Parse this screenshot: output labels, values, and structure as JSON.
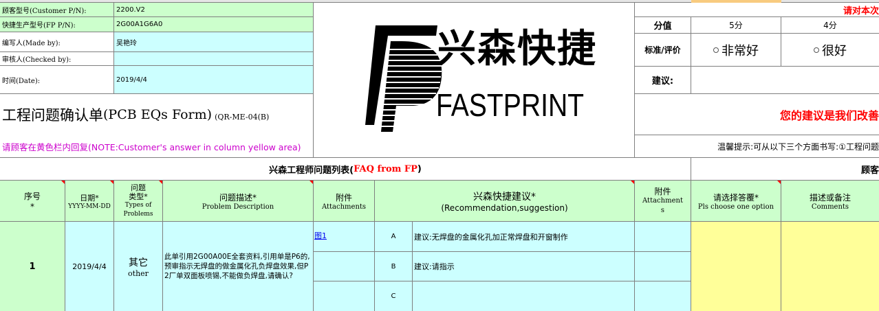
{
  "info": {
    "customer_pn_label": "顾客型号(Customer P/N):",
    "customer_pn_value": "2200.V2",
    "fp_pn_label": "快捷生产型号(FP P/N):",
    "fp_pn_value": "2G00A1G6A0",
    "made_by_label": "编写人(Made by):",
    "made_by_value": "吴艳玲",
    "checked_by_label": "审核人(Checked by):",
    "checked_by_value": "",
    "date_label": "时间(Date):",
    "date_value": "2019/4/4"
  },
  "form_title": {
    "main": "工程问题确认单",
    "en": "(PCB EQs Form)",
    "code": "(QR-ME-04(B)"
  },
  "notice": "请顾客在黄色栏内回复(NOTE:Customer's answer in column yellow area)",
  "logo": {
    "cn": "兴森快捷",
    "en": "FASTPRINT"
  },
  "rating": {
    "top_right_red": "请对本次",
    "score_label": "分值",
    "score_5": "5分",
    "score_4": "4分",
    "standard_label": "标准/评价",
    "option_1": "非常好",
    "option_2": "很好",
    "advice_label": "建议:",
    "improve_text": "您的建议是我们改善",
    "tip_text": "温馨提示:可从以下三个方面书写:①工程问题"
  },
  "section": {
    "left_title_cn": "兴森工程师问题列表(",
    "left_title_faq": "FAQ from FP",
    "left_title_end": ")",
    "right_title": "顾客"
  },
  "headers": {
    "seq": "序号",
    "seq_star": "*",
    "date": "日期*",
    "date_fmt": "YYYY-MM-DD",
    "type_1": "问题",
    "type_2": "类型*",
    "type_3": "Types of",
    "type_4": "Problems",
    "desc_1": "问题描述*",
    "desc_2": "Problem Description",
    "att_1": "附件",
    "att_2": "Attachments",
    "rec_1": "兴森快捷建议*",
    "rec_2": "(Recommendation,suggestion)",
    "att2_1": "附件",
    "att2_2": "Attachment",
    "att2_3": "s",
    "choose_1": "请选择答覆*",
    "choose_2": "Pls choose one option",
    "comm_1": "描述或备注",
    "comm_2": "Comments"
  },
  "row": {
    "seq": "1",
    "date": "2019/4/4",
    "type_cn": "其它",
    "type_en": "other",
    "desc": "此单引用2G00A00E全套资料,引用单是P6的,预审指示无焊盘的做金属化孔负焊盘效果,但P2厂单双面板喷锡,不能做负焊盘,请确认?",
    "attachment": "图1",
    "opt_a": "A",
    "opt_b": "B",
    "opt_c": "C",
    "sugg_a": "建议:无焊盘的金属化孔加正常焊盘和开窗制作",
    "sugg_b": "建议:请指示",
    "sugg_c": ""
  },
  "colors": {
    "green": "#ccffcc",
    "cyan": "#ccffff",
    "yellow": "#ffff99",
    "red": "#ff0000",
    "magenta": "#cc00cc"
  }
}
